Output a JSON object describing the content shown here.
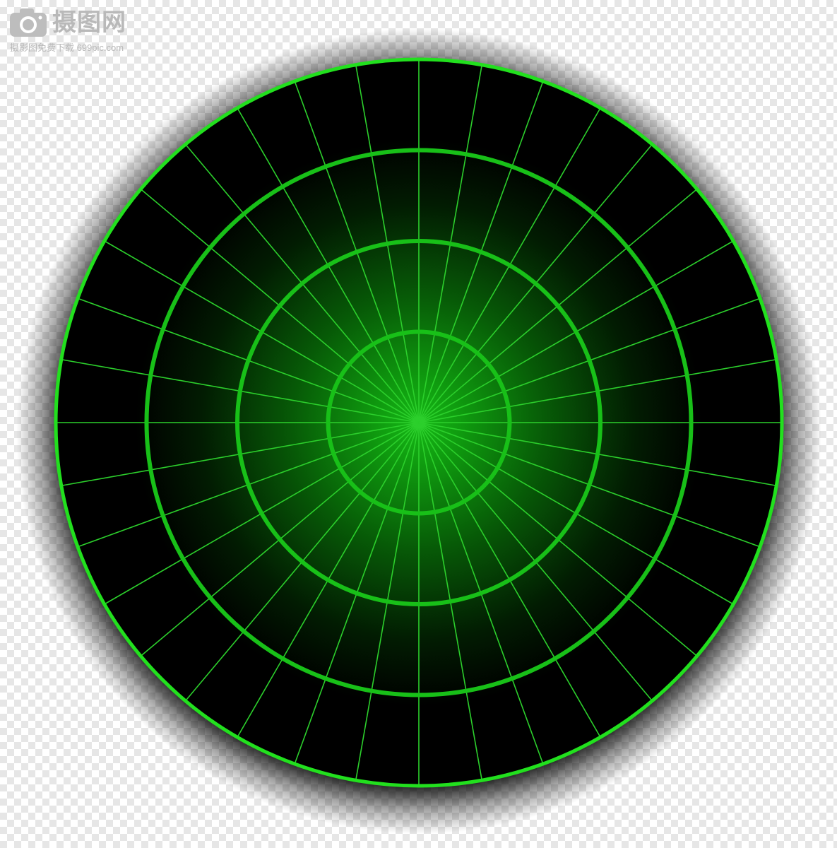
{
  "watermark": {
    "title": "摄图网",
    "subtitle": "摄影图免费下载 699pic.com",
    "logo_icon": "camera-icon",
    "color": "#b9b9b9"
  },
  "radar": {
    "rim_color": "#22e01e",
    "ring_color": "#18c018",
    "spoke_color": "#2ccf2c",
    "center_glow": "#14b414",
    "screen_color": "#000000",
    "ring_count": 4,
    "spoke_count": 36
  }
}
